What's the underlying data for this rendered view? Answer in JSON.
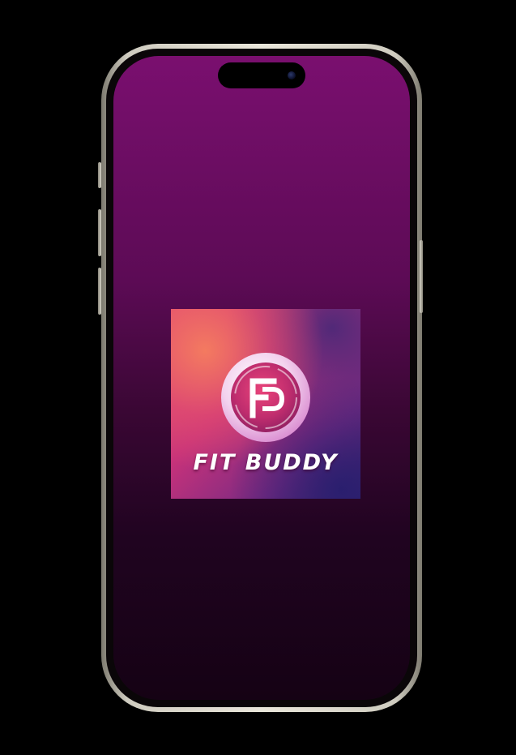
{
  "app": {
    "name": "FIT BUDDY",
    "emblem_letters": "FB"
  },
  "colors": {
    "screen_top": "#7a0f6f",
    "screen_bottom": "#150214",
    "logo_accent": "#e85a6c",
    "emblem_ring": "#f4d6ef"
  },
  "icons": {
    "logo": "fit-buddy-logo-icon",
    "camera": "front-camera-icon"
  }
}
